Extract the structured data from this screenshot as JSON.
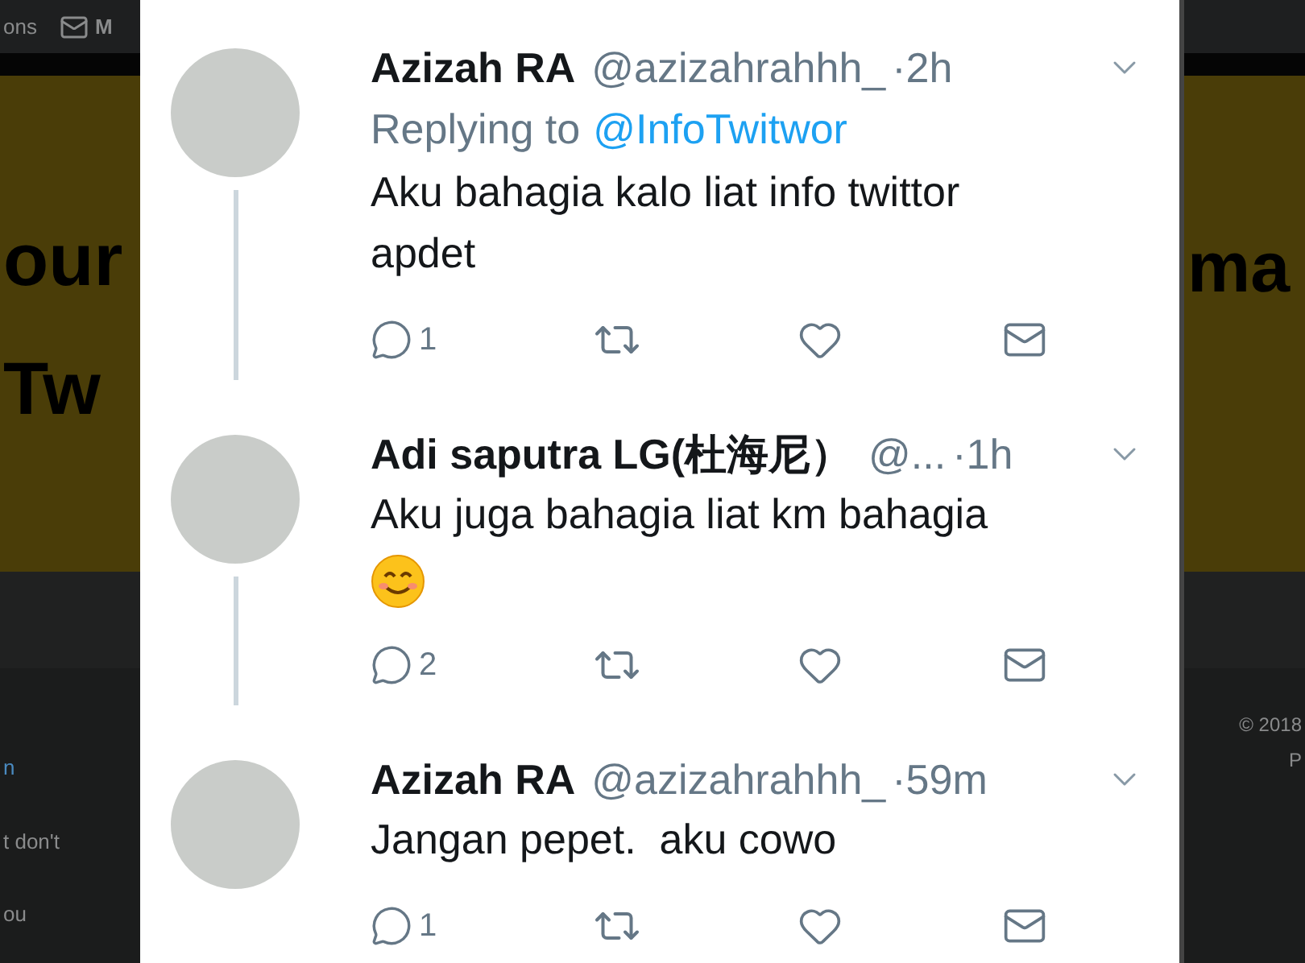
{
  "background": {
    "left": {
      "nav_text": "ons",
      "nav_mail": "M",
      "banner_lines": [
        "our",
        "Tw"
      ],
      "link": "n",
      "body_lines": [
        "t don't",
        "ou"
      ]
    },
    "right": {
      "banner_lines": [
        "ma"
      ],
      "footer_lines": [
        "© 2018",
        "P"
      ]
    }
  },
  "tweets": [
    {
      "name": "Azizah RA",
      "handle": "@azizahrahhh_",
      "time": "·2h",
      "replying_to": {
        "label": "Replying to",
        "handle": "@InfoTwitwor"
      },
      "text": "Aku bahagia kalo liat info twittor apdet",
      "emoji": false,
      "replies": "1",
      "thread_line": true
    },
    {
      "name": "Adi saputra LG(杜海尼）",
      "handle": "@...",
      "time": "·1h",
      "text": "Aku juga bahagia liat km bahagia",
      "emoji": true,
      "replies": "2",
      "thread_line": true
    },
    {
      "name": "Azizah RA",
      "handle": "@azizahrahhh_",
      "time": "·59m",
      "text": "Jangan pepet.  aku cowo",
      "emoji": false,
      "replies": "1",
      "thread_line": false
    }
  ]
}
